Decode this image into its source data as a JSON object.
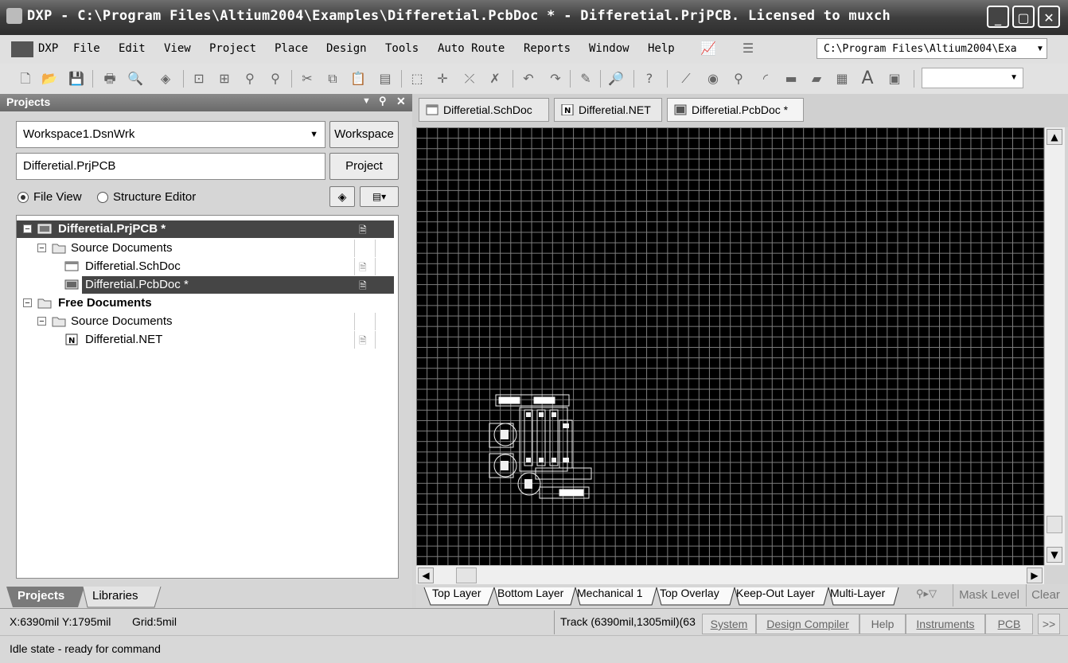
{
  "window": {
    "title": "DXP - C:\\Program Files\\Altium2004\\Examples\\Differetial.PcbDoc * - Differetial.PrjPCB. Licensed to muxch",
    "minimize_icon": "minimize-icon",
    "restore_icon": "restore-icon",
    "close_icon": "close-icon"
  },
  "menubar": {
    "dxp": "DXP",
    "items": [
      "File",
      "Edit",
      "View",
      "Project",
      "Place",
      "Design",
      "Tools",
      "Auto Route",
      "Reports",
      "Window",
      "Help"
    ],
    "path": "C:\\Program Files\\Altium2004\\Exa"
  },
  "projects_panel": {
    "title": "Projects",
    "workspace_value": "Workspace1.DsnWrk",
    "workspace_button": "Workspace",
    "project_value": "Differetial.PrjPCB",
    "project_button": "Project",
    "file_view_label": "File View",
    "structure_editor_label": "Structure Editor",
    "tree": {
      "project": "Differetial.PrjPCB *",
      "source_docs": "Source Documents",
      "schdoc": "Differetial.SchDoc",
      "pcbdoc": "Differetial.PcbDoc *",
      "free_docs": "Free Documents",
      "free_source_docs": "Source Documents",
      "net": "Differetial.NET"
    },
    "tabs": [
      "Projects",
      "Libraries"
    ]
  },
  "doc_tabs": [
    "Differetial.SchDoc",
    "Differetial.NET",
    "Differetial.PcbDoc *"
  ],
  "layer_tabs": [
    "Top Layer",
    "Bottom Layer",
    "Mechanical 1",
    "Top Overlay",
    "Keep-Out Layer",
    "Multi-Layer"
  ],
  "layer_controls": {
    "mask_level": "Mask Level",
    "clear": "Clear"
  },
  "status": {
    "coords": "X:6390mil Y:1795mil",
    "grid": "Grid:5mil",
    "track": "Track (6390mil,1305mil)(63",
    "buttons": [
      "System",
      "Design Compiler",
      "Help",
      "Instruments",
      "PCB"
    ],
    "more": ">>",
    "message": "Idle state - ready for command"
  },
  "colors": {
    "canvas_bg": "#000000",
    "grid_line": "#808080",
    "selected_row": "#454545"
  }
}
